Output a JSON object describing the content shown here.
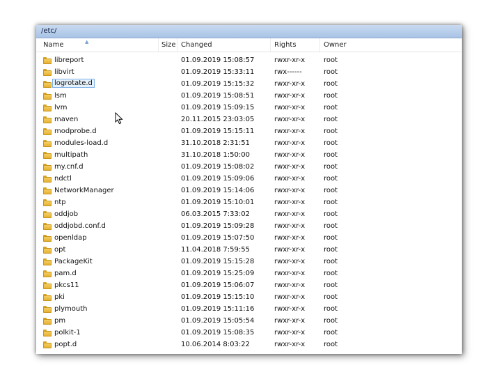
{
  "path": "/etc/",
  "columns": {
    "name": "Name",
    "size": "Size",
    "changed": "Changed",
    "rights": "Rights",
    "owner": "Owner"
  },
  "rows": [
    {
      "name": "libreport",
      "changed": "01.09.2019 15:08:57",
      "rights": "rwxr-xr-x",
      "owner": "root"
    },
    {
      "name": "libvirt",
      "changed": "01.09.2019 15:33:11",
      "rights": "rwx------",
      "owner": "root"
    },
    {
      "name": "logrotate.d",
      "changed": "01.09.2019 15:15:32",
      "rights": "rwxr-xr-x",
      "owner": "root",
      "selected": true
    },
    {
      "name": "lsm",
      "changed": "01.09.2019 15:08:51",
      "rights": "rwxr-xr-x",
      "owner": "root"
    },
    {
      "name": "lvm",
      "changed": "01.09.2019 15:09:15",
      "rights": "rwxr-xr-x",
      "owner": "root"
    },
    {
      "name": "maven",
      "changed": "20.11.2015 23:03:05",
      "rights": "rwxr-xr-x",
      "owner": "root"
    },
    {
      "name": "modprobe.d",
      "changed": "01.09.2019 15:15:11",
      "rights": "rwxr-xr-x",
      "owner": "root"
    },
    {
      "name": "modules-load.d",
      "changed": "31.10.2018 2:31:51",
      "rights": "rwxr-xr-x",
      "owner": "root"
    },
    {
      "name": "multipath",
      "changed": "31.10.2018 1:50:00",
      "rights": "rwxr-xr-x",
      "owner": "root"
    },
    {
      "name": "my.cnf.d",
      "changed": "01.09.2019 15:08:02",
      "rights": "rwxr-xr-x",
      "owner": "root"
    },
    {
      "name": "ndctl",
      "changed": "01.09.2019 15:09:06",
      "rights": "rwxr-xr-x",
      "owner": "root"
    },
    {
      "name": "NetworkManager",
      "changed": "01.09.2019 15:14:06",
      "rights": "rwxr-xr-x",
      "owner": "root"
    },
    {
      "name": "ntp",
      "changed": "01.09.2019 15:10:01",
      "rights": "rwxr-xr-x",
      "owner": "root"
    },
    {
      "name": "oddjob",
      "changed": "06.03.2015 7:33:02",
      "rights": "rwxr-xr-x",
      "owner": "root"
    },
    {
      "name": "oddjobd.conf.d",
      "changed": "01.09.2019 15:09:28",
      "rights": "rwxr-xr-x",
      "owner": "root"
    },
    {
      "name": "openldap",
      "changed": "01.09.2019 15:07:50",
      "rights": "rwxr-xr-x",
      "owner": "root"
    },
    {
      "name": "opt",
      "changed": "11.04.2018 7:59:55",
      "rights": "rwxr-xr-x",
      "owner": "root"
    },
    {
      "name": "PackageKit",
      "changed": "01.09.2019 15:15:28",
      "rights": "rwxr-xr-x",
      "owner": "root"
    },
    {
      "name": "pam.d",
      "changed": "01.09.2019 15:25:09",
      "rights": "rwxr-xr-x",
      "owner": "root"
    },
    {
      "name": "pkcs11",
      "changed": "01.09.2019 15:06:07",
      "rights": "rwxr-xr-x",
      "owner": "root"
    },
    {
      "name": "pki",
      "changed": "01.09.2019 15:15:10",
      "rights": "rwxr-xr-x",
      "owner": "root"
    },
    {
      "name": "plymouth",
      "changed": "01.09.2019 15:11:16",
      "rights": "rwxr-xr-x",
      "owner": "root"
    },
    {
      "name": "pm",
      "changed": "01.09.2019 15:05:54",
      "rights": "rwxr-xr-x",
      "owner": "root"
    },
    {
      "name": "polkit-1",
      "changed": "01.09.2019 15:08:35",
      "rights": "rwxr-xr-x",
      "owner": "root"
    },
    {
      "name": "popt.d",
      "changed": "10.06.2014 8:03:22",
      "rights": "rwxr-xr-x",
      "owner": "root"
    }
  ],
  "icons": {
    "folder": "folder-icon",
    "cursor": "mouse-pointer-icon",
    "sort": "sort-ascending-icon"
  },
  "colors": {
    "pathbar": "#b9cfee",
    "folder": "#f2c04a",
    "selection_border": "#7fb0e8",
    "selection_fill": "#e5f1fb"
  }
}
